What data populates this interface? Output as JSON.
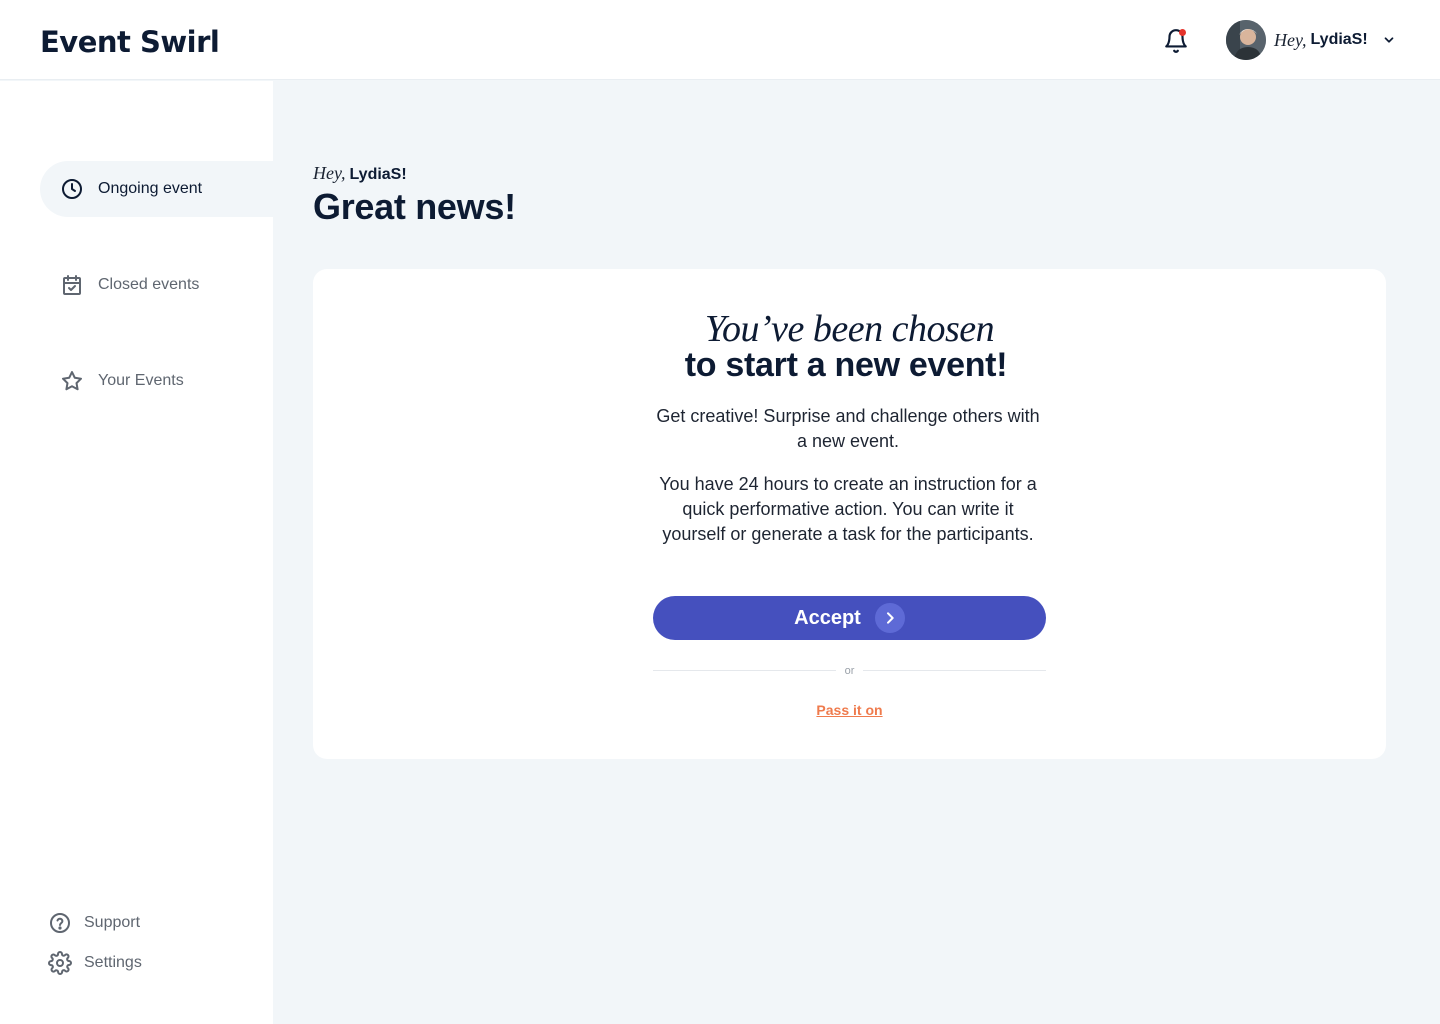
{
  "header": {
    "logo": "Event Swirl",
    "greeting": "Hey,",
    "user_name": "LydiaS!",
    "has_notification": true
  },
  "sidebar": {
    "items": [
      {
        "label": "Ongoing event",
        "icon": "clock-icon",
        "active": true
      },
      {
        "label": "Closed events",
        "icon": "calendar-check-icon",
        "active": false
      },
      {
        "label": "Your Events",
        "icon": "star-icon",
        "active": false
      }
    ],
    "footer": [
      {
        "label": "Support",
        "icon": "help-circle-icon"
      },
      {
        "label": "Settings",
        "icon": "gear-icon"
      }
    ]
  },
  "main": {
    "greeting": "Hey,",
    "user_name": "LydiaS!",
    "title": "Great news!",
    "card": {
      "chosen": "You’ve been chosen",
      "headline": "to start a new event!",
      "paragraph1": "Get creative! Surprise and challenge others with a new event.",
      "paragraph2": "You have 24 hours to create an instruction for a quick performative action. You can write it yourself or generate a task for the participants.",
      "accept_label": "Accept",
      "or_label": "or",
      "pass_label": "Pass it on"
    }
  },
  "colors": {
    "primary": "#4550be",
    "accent": "#ef7b4d",
    "background": "#f2f6f9",
    "text": "#0d1b33"
  }
}
